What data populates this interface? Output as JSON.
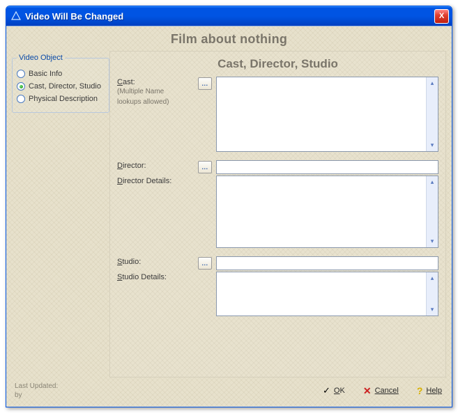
{
  "window": {
    "title": "Video Will Be Changed",
    "close_glyph": "X"
  },
  "page": {
    "title": "Film about nothing",
    "panel_title": "Cast, Director, Studio"
  },
  "sidebar": {
    "legend": "Video Object",
    "items": [
      {
        "label": "Basic Info",
        "checked": false
      },
      {
        "label": "Cast, Director, Studio",
        "checked": true
      },
      {
        "label": "Physical Description",
        "checked": false
      }
    ]
  },
  "form": {
    "cast": {
      "label": "Cast:",
      "sublabel1": "(Multiple Name",
      "sublabel2": " lookups allowed)",
      "lookup_label": "...",
      "value": ""
    },
    "director": {
      "label": "Director:",
      "lookup_label": "...",
      "value": ""
    },
    "director_details": {
      "label": "Director Details:",
      "value": ""
    },
    "studio": {
      "label": "Studio:",
      "lookup_label": "...",
      "value": ""
    },
    "studio_details": {
      "label": "Studio Details:",
      "value": ""
    }
  },
  "footer": {
    "last_updated_label": "Last Updated:",
    "by_label": "by",
    "ok_label": "OK",
    "cancel_label": "Cancel",
    "help_label": "Help"
  },
  "glyphs": {
    "up_arrow": "▴",
    "down_arrow": "▾",
    "check": "✓",
    "cross": "✕",
    "question": "?"
  }
}
